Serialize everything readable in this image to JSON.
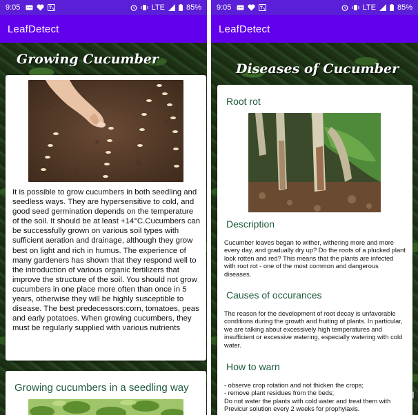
{
  "left_screen": {
    "status": {
      "time": "9:05",
      "network": "LTE",
      "battery": "85%"
    },
    "app_title": "LeafDetect",
    "heading": "Growing Cucumber",
    "body_text": "It is possible to grow cucumbers in both seedling and seedless ways. They are hypersensitive to cold, and good seed germination depends on the temperature of the soil. It should be at least +14°C.Cucumbers can be successfully grown on various soil types with sufficient aeration and drainage, although they grow best on light and rich in humus. The experience of many gardeners has shown that they respond well to the introduction of various organic fertilizers that improve the structure of the soil. You should not grow cucumbers in one place more often than once in 5 years, otherwise they will be highly susceptible to disease. The best predecessors:corn, tomatoes, peas and early potatoes. When growing cucumbers, they must be regularly supplied with various nutrients",
    "second_card_title": "Growing cucumbers in a seedling way"
  },
  "right_screen": {
    "status": {
      "time": "9:05",
      "network": "LTE",
      "battery": "85%"
    },
    "app_title": "LeafDetect",
    "heading": "Diseases of Cucumber",
    "disease_title": "Root rot",
    "description_title": "Description",
    "description_text": "Cucumber leaves began to wither, withering more and more every day, and gradually dry up? Do the roots of a plucked plant look rotten and red? This means that the plants are infected with root rot - one of the most common and dangerous diseases.",
    "causes_title": "Causes of occurances",
    "causes_text": "The reason for the development of root decay is unfavorable conditions during the growth and fruiting of plants. In particular, we are talking about excessively high temperatures and insufficient or excessive watering, especially watering with cold water.",
    "warn_title": "How to warn",
    "warn_lines": [
      "- observe crop rotation and not thicken the crops;",
      "- remove plant residues from the beds;",
      "Do not water the plants with cold water and treat them with Previcur solution every 2 weeks for prophylaxis."
    ]
  },
  "colors": {
    "status_bar": "#5a1fd6",
    "app_bar": "#6200ee",
    "section_title": "#1d5a3a"
  },
  "icons": [
    "alarm-icon",
    "vibrate-icon",
    "signal-icon",
    "battery-icon",
    "sms-icon",
    "heart-icon",
    "translate-icon"
  ]
}
